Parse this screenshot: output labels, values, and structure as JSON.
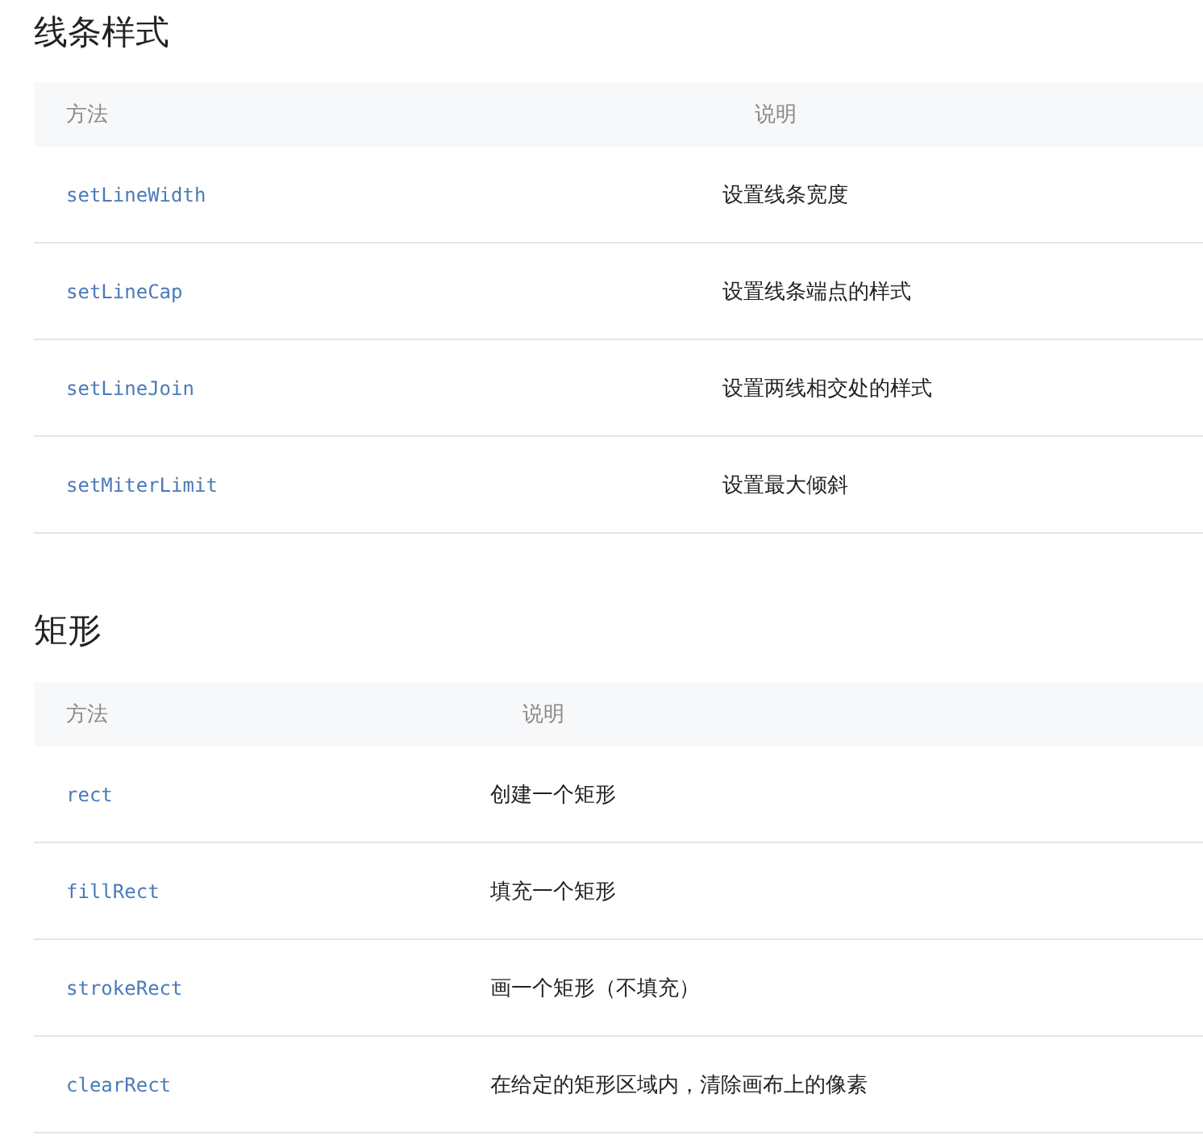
{
  "sections": [
    {
      "title": "线条样式",
      "columns": [
        "方法",
        "说明"
      ],
      "rows": [
        {
          "method": "setLineWidth",
          "description": "设置线条宽度"
        },
        {
          "method": "setLineCap",
          "description": "设置线条端点的样式"
        },
        {
          "method": "setLineJoin",
          "description": "设置两线相交处的样式"
        },
        {
          "method": "setMiterLimit",
          "description": "设置最大倾斜"
        }
      ]
    },
    {
      "title": "矩形",
      "columns": [
        "方法",
        "说明"
      ],
      "rows": [
        {
          "method": "rect",
          "description": "创建一个矩形"
        },
        {
          "method": "fillRect",
          "description": "填充一个矩形"
        },
        {
          "method": "strokeRect",
          "description": "画一个矩形（不填充）"
        },
        {
          "method": "clearRect",
          "description": "在给定的矩形区域内，清除画布上的像素"
        }
      ]
    }
  ]
}
